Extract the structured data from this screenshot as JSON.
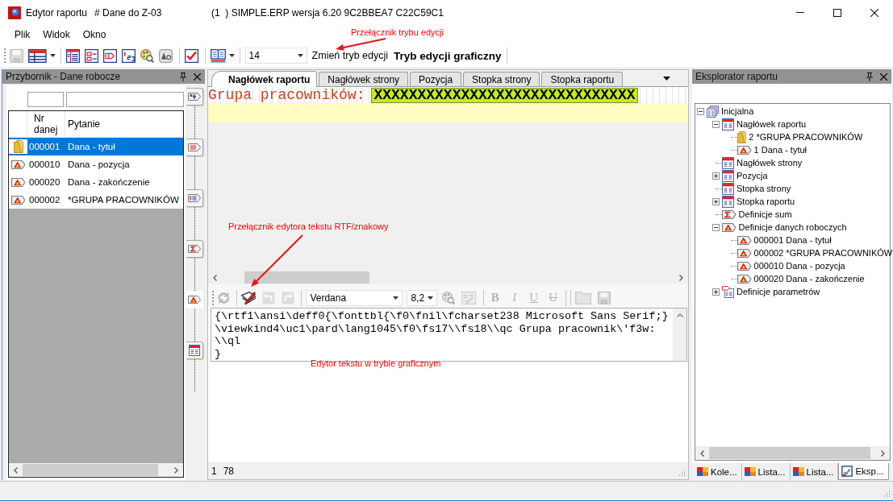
{
  "window": {
    "title": "Edytor raportu",
    "document": "# Dane do Z-03",
    "app_info": "(1  ) SIMPLE.ERP wersja 6.20 9C2BBEA7 C22C59C1"
  },
  "menu": [
    {
      "label": "Plik"
    },
    {
      "label": "Widok"
    },
    {
      "label": "Okno"
    }
  ],
  "toolbar": {
    "tools": [
      {
        "kind": "save",
        "disabled": true
      },
      {
        "kind": "grid-menu",
        "disabled": false
      },
      {
        "kind": "separator"
      },
      {
        "kind": "table-lines",
        "disabled": false
      },
      {
        "kind": "page-fields",
        "disabled": false
      },
      {
        "kind": "page-tag",
        "disabled": false
      },
      {
        "kind": "numbered",
        "disabled": false
      },
      {
        "kind": "palette",
        "disabled": false
      },
      {
        "kind": "font-preview",
        "disabled": false
      },
      {
        "kind": "separator"
      },
      {
        "kind": "checklist",
        "disabled": false
      },
      {
        "kind": "separator"
      },
      {
        "kind": "book-menu",
        "disabled": false
      },
      {
        "kind": "separator"
      }
    ],
    "font_size": "14",
    "mode_button": "Zmień tryb edycji",
    "mode_label": "Tryb edycji graficzny"
  },
  "toolbox": {
    "title": "Przybornik - Dane robocze",
    "columns": [
      {
        "label": "Nr danej"
      },
      {
        "label": "Pytanie"
      }
    ],
    "rows": [
      {
        "kind": "folder",
        "number": "000001",
        "question": "Dana - tytuł",
        "selected": true
      },
      {
        "kind": "data",
        "number": "000010",
        "question": "Dana - pozycja",
        "selected": false
      },
      {
        "kind": "data",
        "number": "000020",
        "question": "Dana - zakończenie",
        "selected": false
      },
      {
        "kind": "data",
        "number": "000002",
        "question": "*GRUPA PRACOWNIKÓW",
        "selected": false
      }
    ],
    "strip": [
      {
        "kind": "field",
        "selected": false
      },
      {
        "kind": "lines",
        "selected": false
      },
      {
        "kind": "list",
        "selected": false
      },
      {
        "kind": "sum",
        "selected": false
      },
      {
        "kind": "data",
        "selected": true
      },
      {
        "kind": "section",
        "selected": false
      }
    ]
  },
  "designer": {
    "tabs": [
      {
        "label": "Nagłówek raportu",
        "selected": true
      },
      {
        "label": "Nagłówek strony",
        "selected": false
      },
      {
        "label": "Pozycja",
        "selected": false
      },
      {
        "label": "Stopka strony",
        "selected": false
      },
      {
        "label": "Stopka raportu",
        "selected": false
      }
    ],
    "band_label": "Grupa pracowników:",
    "band_field": "XXXXXXXXXXXXXXXXXXXXXXXXXXXXXX"
  },
  "rtf_editor": {
    "tools": [
      {
        "kind": "sync",
        "disabled": true
      },
      {
        "kind": "separator"
      },
      {
        "kind": "editor-toggle",
        "disabled": false
      },
      {
        "kind": "undo",
        "disabled": true
      },
      {
        "kind": "redo",
        "disabled": true
      },
      {
        "kind": "separator"
      },
      {
        "kind": "font",
        "value": "Verdana"
      },
      {
        "kind": "size",
        "value": "8,2"
      },
      {
        "kind": "palette",
        "disabled": true
      },
      {
        "kind": "spellcheck",
        "disabled": true
      },
      {
        "kind": "separator"
      },
      {
        "kind": "bold",
        "label": "B",
        "disabled": true
      },
      {
        "kind": "italic",
        "label": "I",
        "disabled": true
      },
      {
        "kind": "underline",
        "label": "U",
        "disabled": true
      },
      {
        "kind": "strike",
        "label": "U",
        "disabled": true
      },
      {
        "kind": "separator"
      },
      {
        "kind": "separator"
      },
      {
        "kind": "open",
        "disabled": true
      },
      {
        "kind": "save",
        "disabled": true
      }
    ],
    "lines": [
      "{\\rtf1\\ansi\\deff0{\\fonttbl{\\f0\\fnil\\fcharset238 Microsoft Sans Serif;}",
      "\\viewkind4\\uc1\\pard\\lang1045\\f0\\fs17\\\\fs18\\\\qc Grupa pracownik\\'f3w:",
      "\\\\ql",
      "}"
    ],
    "status_line": "1",
    "status_column": "78"
  },
  "explorer": {
    "title": "Eksplorator raportu",
    "tree": [
      {
        "label": "Inicjalna",
        "kind": "report",
        "expanded": true,
        "children": [
          {
            "label": "Nagłówek raportu",
            "kind": "section",
            "expanded": true,
            "children": [
              {
                "label": "2 *GRUPA PRACOWNIKÓW",
                "kind": "folder"
              },
              {
                "label": "1 Dana - tytuł",
                "kind": "data"
              }
            ]
          },
          {
            "label": "Nagłówek strony",
            "kind": "section"
          },
          {
            "label": "Pozycja",
            "kind": "section",
            "expanded": false
          },
          {
            "label": "Stopka strony",
            "kind": "section"
          },
          {
            "label": "Stopka raportu",
            "kind": "section",
            "expanded": false
          },
          {
            "label": "Definicje sum",
            "kind": "sum"
          },
          {
            "label": "Definicje danych roboczych",
            "kind": "data",
            "expanded": true,
            "children": [
              {
                "label": "000001 Dana - tytuł",
                "kind": "data"
              },
              {
                "label": "000002 *GRUPA PRACOWNIKÓW",
                "kind": "data"
              },
              {
                "label": "000010 Dana - pozycja",
                "kind": "data"
              },
              {
                "label": "000020 Dana - zakończenie",
                "kind": "data"
              }
            ]
          },
          {
            "label": "Definicje parametrów",
            "kind": "params",
            "expanded": false
          }
        ]
      }
    ]
  },
  "dock_tabs": [
    {
      "label": "Kole...",
      "kind": "tiles",
      "selected": false
    },
    {
      "label": "Lista...",
      "kind": "tiles",
      "selected": false
    },
    {
      "label": "Lista...",
      "kind": "tiles",
      "selected": false
    },
    {
      "label": "Eksp...",
      "kind": "explorer",
      "selected": true
    }
  ],
  "annotations": [
    {
      "text": "Przełącznik trybu edycji",
      "arrow": true
    },
    {
      "text": "Przełącznik edytora tekstu RTF/znakowy",
      "arrow": true
    },
    {
      "text": "Edytor tekstu w trybie graficznym",
      "arrow": false
    }
  ]
}
